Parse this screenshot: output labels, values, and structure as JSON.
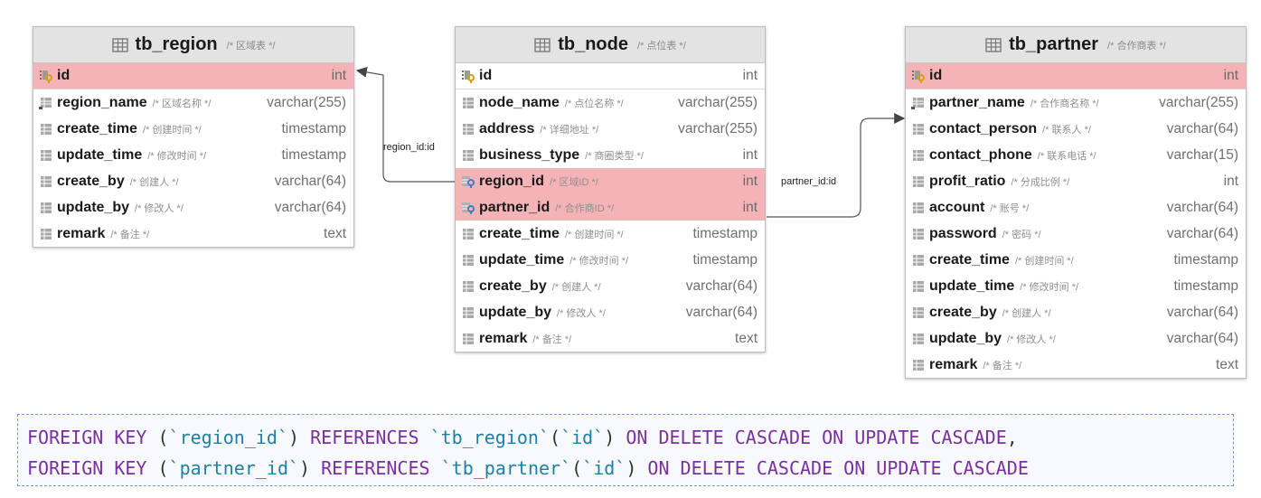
{
  "tables": {
    "region": {
      "name": "tb_region",
      "comment": "/* 区域表 */",
      "rows": [
        {
          "name": "id",
          "comment": "",
          "type": "int",
          "icon": "primary-key-icon",
          "highlight": true
        },
        {
          "name": "region_name",
          "comment": "/* 区域名称 */",
          "type": "varchar(255)",
          "icon": "index-column-icon"
        },
        {
          "name": "create_time",
          "comment": "/* 创建时间 */",
          "type": "timestamp",
          "icon": "column-icon"
        },
        {
          "name": "update_time",
          "comment": "/* 修改时间 */",
          "type": "timestamp",
          "icon": "column-icon"
        },
        {
          "name": "create_by",
          "comment": "/* 创建人 */",
          "type": "varchar(64)",
          "icon": "column-icon"
        },
        {
          "name": "update_by",
          "comment": "/* 修改人 */",
          "type": "varchar(64)",
          "icon": "column-icon"
        },
        {
          "name": "remark",
          "comment": "/* 备注 */",
          "type": "text",
          "icon": "column-icon"
        }
      ]
    },
    "node": {
      "name": "tb_node",
      "comment": "/* 点位表 */",
      "rows": [
        {
          "name": "id",
          "comment": "",
          "type": "int",
          "icon": "primary-key-icon"
        },
        {
          "name": "node_name",
          "comment": "/* 点位名称 */",
          "type": "varchar(255)",
          "icon": "column-icon"
        },
        {
          "name": "address",
          "comment": "/* 详细地址 */",
          "type": "varchar(255)",
          "icon": "column-icon"
        },
        {
          "name": "business_type",
          "comment": "/* 商圈类型 */",
          "type": "int",
          "icon": "column-icon"
        },
        {
          "name": "region_id",
          "comment": "/* 区域ID */",
          "type": "int",
          "icon": "foreign-key-icon",
          "highlight": true
        },
        {
          "name": "partner_id",
          "comment": "/* 合作商ID */",
          "type": "int",
          "icon": "foreign-key-icon",
          "highlight": true
        },
        {
          "name": "create_time",
          "comment": "/* 创建时间 */",
          "type": "timestamp",
          "icon": "column-icon"
        },
        {
          "name": "update_time",
          "comment": "/* 修改时间 */",
          "type": "timestamp",
          "icon": "column-icon"
        },
        {
          "name": "create_by",
          "comment": "/* 创建人 */",
          "type": "varchar(64)",
          "icon": "column-icon"
        },
        {
          "name": "update_by",
          "comment": "/* 修改人 */",
          "type": "varchar(64)",
          "icon": "column-icon"
        },
        {
          "name": "remark",
          "comment": "/* 备注 */",
          "type": "text",
          "icon": "column-icon"
        }
      ]
    },
    "partner": {
      "name": "tb_partner",
      "comment": "/* 合作商表 */",
      "rows": [
        {
          "name": "id",
          "comment": "",
          "type": "int",
          "icon": "primary-key-icon",
          "highlight": true
        },
        {
          "name": "partner_name",
          "comment": "/* 合作商名称 */",
          "type": "varchar(255)",
          "icon": "index-column-icon"
        },
        {
          "name": "contact_person",
          "comment": "/* 联系人 */",
          "type": "varchar(64)",
          "icon": "column-icon"
        },
        {
          "name": "contact_phone",
          "comment": "/* 联系电话 */",
          "type": "varchar(15)",
          "icon": "column-icon"
        },
        {
          "name": "profit_ratio",
          "comment": "/* 分成比例 */",
          "type": "int",
          "icon": "column-icon"
        },
        {
          "name": "account",
          "comment": "/* 账号 */",
          "type": "varchar(64)",
          "icon": "column-icon"
        },
        {
          "name": "password",
          "comment": "/* 密码 */",
          "type": "varchar(64)",
          "icon": "column-icon"
        },
        {
          "name": "create_time",
          "comment": "/* 创建时间 */",
          "type": "timestamp",
          "icon": "column-icon"
        },
        {
          "name": "update_time",
          "comment": "/* 修改时间 */",
          "type": "timestamp",
          "icon": "column-icon"
        },
        {
          "name": "create_by",
          "comment": "/* 创建人 */",
          "type": "varchar(64)",
          "icon": "column-icon"
        },
        {
          "name": "update_by",
          "comment": "/* 修改人 */",
          "type": "varchar(64)",
          "icon": "column-icon"
        },
        {
          "name": "remark",
          "comment": "/* 备注 */",
          "type": "text",
          "icon": "column-icon"
        }
      ]
    }
  },
  "relations": {
    "region": "region_id:id",
    "partner": "partner_id:id"
  },
  "sql": {
    "line1": [
      {
        "t": "FOREIGN KEY",
        "c": "kw"
      },
      {
        "t": " (",
        "c": "punct"
      },
      {
        "t": "`region_id`",
        "c": "str"
      },
      {
        "t": ") ",
        "c": "punct"
      },
      {
        "t": "REFERENCES",
        "c": "kw"
      },
      {
        "t": " ",
        "c": "punct"
      },
      {
        "t": "`tb_region`",
        "c": "str"
      },
      {
        "t": "(",
        "c": "punct"
      },
      {
        "t": "`id`",
        "c": "str"
      },
      {
        "t": ") ",
        "c": "punct"
      },
      {
        "t": "ON DELETE CASCADE ON UPDATE CASCADE",
        "c": "kw"
      },
      {
        "t": ",",
        "c": "punct"
      }
    ],
    "line2": [
      {
        "t": "FOREIGN KEY",
        "c": "kw"
      },
      {
        "t": " (",
        "c": "punct"
      },
      {
        "t": "`partner_id`",
        "c": "str"
      },
      {
        "t": ") ",
        "c": "punct"
      },
      {
        "t": "REFERENCES",
        "c": "kw"
      },
      {
        "t": " ",
        "c": "punct"
      },
      {
        "t": "`tb_partner`",
        "c": "str"
      },
      {
        "t": "(",
        "c": "punct"
      },
      {
        "t": "`id`",
        "c": "str"
      },
      {
        "t": ") ",
        "c": "punct"
      },
      {
        "t": "ON DELETE CASCADE ON UPDATE CASCADE",
        "c": "kw"
      }
    ]
  },
  "colors": {
    "highlight": "#f4b3b6",
    "header": "#e3e3e3",
    "keyword": "#7b2fa0",
    "identifier": "#1f7fa6"
  }
}
